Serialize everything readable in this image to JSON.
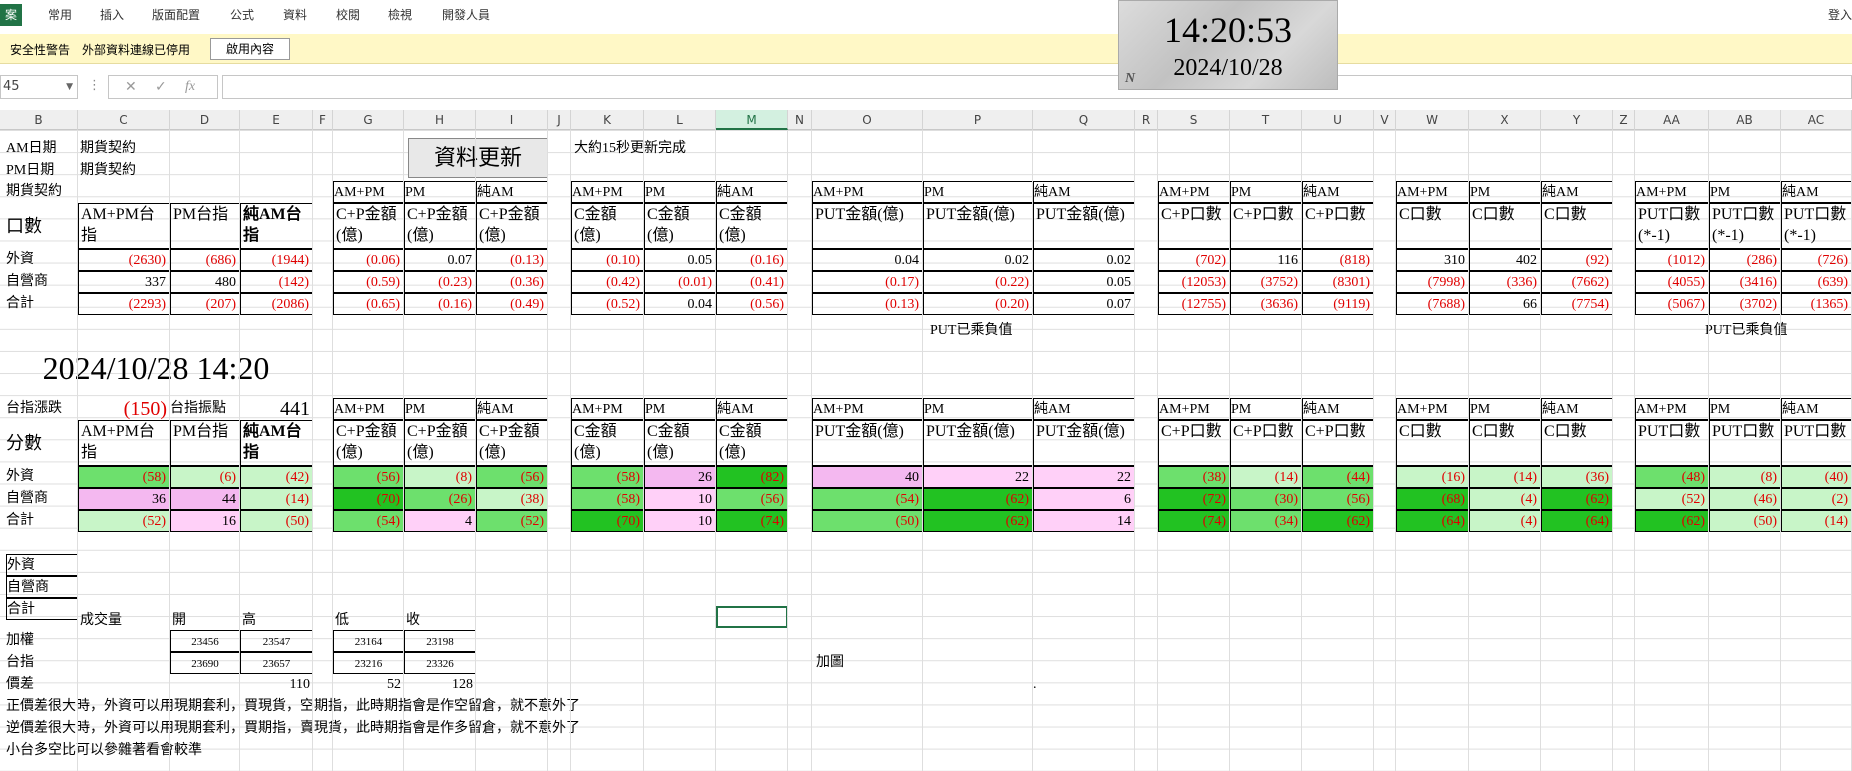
{
  "ribbon": {
    "file": "案",
    "tabs": [
      "常用",
      "插入",
      "版面配置",
      "公式",
      "資料",
      "校閱",
      "檢視",
      "開發人員"
    ],
    "login": "登入"
  },
  "security": {
    "title": "安全性警告",
    "message": "外部資料連線已停用",
    "button": "啟用內容"
  },
  "formula_bar": {
    "name_box": "45",
    "value": ""
  },
  "clock": {
    "time": "14:20:53",
    "date": "2024/10/28",
    "mark": "N"
  },
  "columns": [
    "B",
    "C",
    "D",
    "E",
    "F",
    "G",
    "H",
    "I",
    "J",
    "K",
    "L",
    "M",
    "N",
    "O",
    "P",
    "Q",
    "R",
    "S",
    "T",
    "U",
    "V",
    "W",
    "X",
    "Y",
    "Z",
    "AA",
    "AB",
    "AC"
  ],
  "sheet": {
    "am_date_label": "AM日期",
    "pm_date_label": "PM日期",
    "contract_label": "期貨契約",
    "contract1": "期貨契約",
    "contract2": "期貨契約",
    "refresh_button": "資料更新",
    "refresh_note": "大約15秒更新完成",
    "put_note": "PUT已乘負值",
    "big_datetime": "2024/10/28 14:20",
    "index_change_label": "台指漲跌",
    "index_change_value": "(150)",
    "index_swing_label": "台指振點",
    "index_swing_value": "441",
    "rows": [
      "外資",
      "自營商",
      "合計"
    ],
    "top_table": {
      "header_a": [
        "AM+PM",
        "PM",
        "純AM"
      ],
      "h_units": "口數",
      "h_units2": "分數",
      "g1h": [
        "AM+PM台指",
        "PM台指",
        "純AM台指"
      ],
      "g2h": [
        "C+P金額(億)",
        "C+P金額(億)",
        "C+P金額(億)"
      ],
      "g3h": [
        "C金額(億)",
        "C金額(億)",
        "C金額(億)"
      ],
      "g4h": [
        "PUT金額(億)",
        "PUT金額(億)",
        "PUT金額(億)"
      ],
      "g5h": [
        "C+P口數",
        "C+P口數",
        "C+P口數"
      ],
      "g6h": [
        "C口數",
        "C口數",
        "C口數"
      ],
      "g7h": [
        "PUT口數(*-1)",
        "PUT口數(*-1)",
        "PUT口數(*-1)"
      ],
      "g1": [
        [
          "(2630)",
          "(686)",
          "(1944)"
        ],
        [
          "337",
          "480",
          "(142)"
        ],
        [
          "(2293)",
          "(207)",
          "(2086)"
        ]
      ],
      "g2": [
        [
          "(0.06)",
          "0.07",
          "(0.13)"
        ],
        [
          "(0.59)",
          "(0.23)",
          "(0.36)"
        ],
        [
          "(0.65)",
          "(0.16)",
          "(0.49)"
        ]
      ],
      "g3": [
        [
          "(0.10)",
          "0.05",
          "(0.16)"
        ],
        [
          "(0.42)",
          "(0.01)",
          "(0.41)"
        ],
        [
          "(0.52)",
          "0.04",
          "(0.56)"
        ]
      ],
      "g4": [
        [
          "0.04",
          "0.02",
          "0.02"
        ],
        [
          "(0.17)",
          "(0.22)",
          "0.05"
        ],
        [
          "(0.13)",
          "(0.20)",
          "0.07"
        ]
      ],
      "g5": [
        [
          "(702)",
          "116",
          "(818)"
        ],
        [
          "(12053)",
          "(3752)",
          "(8301)"
        ],
        [
          "(12755)",
          "(3636)",
          "(9119)"
        ]
      ],
      "g6": [
        [
          "310",
          "402",
          "(92)"
        ],
        [
          "(7998)",
          "(336)",
          "(7662)"
        ],
        [
          "(7688)",
          "66",
          "(7754)"
        ]
      ],
      "g7": [
        [
          "(1012)",
          "(286)",
          "(726)"
        ],
        [
          "(4055)",
          "(3416)",
          "(639)"
        ],
        [
          "(5067)",
          "(3702)",
          "(1365)"
        ]
      ]
    },
    "bottom_table": {
      "g7h": [
        "PUT口數",
        "PUT口數",
        "PUT口數"
      ],
      "g1": [
        [
          "(58)",
          "(6)",
          "(42)"
        ],
        [
          "36",
          "44",
          "(14)"
        ],
        [
          "(52)",
          "16",
          "(50)"
        ]
      ],
      "g2": [
        [
          "(56)",
          "(8)",
          "(56)"
        ],
        [
          "(70)",
          "(26)",
          "(38)"
        ],
        [
          "(54)",
          "4",
          "(52)"
        ]
      ],
      "g3": [
        [
          "(58)",
          "26",
          "(82)"
        ],
        [
          "(58)",
          "10",
          "(56)"
        ],
        [
          "(70)",
          "10",
          "(74)"
        ]
      ],
      "g4": [
        [
          "40",
          "22",
          "22"
        ],
        [
          "(54)",
          "(62)",
          "6"
        ],
        [
          "(50)",
          "(62)",
          "14"
        ]
      ],
      "g5": [
        [
          "(38)",
          "(14)",
          "(44)"
        ],
        [
          "(72)",
          "(30)",
          "(56)"
        ],
        [
          "(74)",
          "(34)",
          "(62)"
        ]
      ],
      "g6": [
        [
          "(16)",
          "(14)",
          "(36)"
        ],
        [
          "(68)",
          "(4)",
          "(62)"
        ],
        [
          "(64)",
          "(4)",
          "(64)"
        ]
      ],
      "g7": [
        [
          "(48)",
          "(8)",
          "(40)"
        ],
        [
          "(52)",
          "(46)",
          "(2)"
        ],
        [
          "(62)",
          "(50)",
          "(14)"
        ]
      ]
    },
    "extra_rows": [
      "外資",
      "自營商",
      "合計"
    ],
    "quote": {
      "vol_label": "成交量",
      "open": "開",
      "high": "高",
      "low": "低",
      "close": "收",
      "rows": [
        {
          "label": "加權",
          "open": "23456",
          "high": "23547",
          "low": "23164",
          "close": "23198"
        },
        {
          "label": "台指",
          "open": "23690",
          "high": "23657",
          "low": "23216",
          "close": "23326"
        }
      ],
      "basis_label": "價差",
      "basis": [
        "110",
        "52",
        "128"
      ]
    },
    "chart_label": "加圖",
    "dot": ".",
    "notes": [
      "正價差很大時，外資可以用現期套利，買現貨，空期指，此時期指會是作空留倉，就不意外了",
      "逆價差很大時，外資可以用現期套利，買期指，賣現貨，此時期指會是作多留倉，就不意外了",
      "小台多空比可以參雜著看會較準"
    ]
  }
}
